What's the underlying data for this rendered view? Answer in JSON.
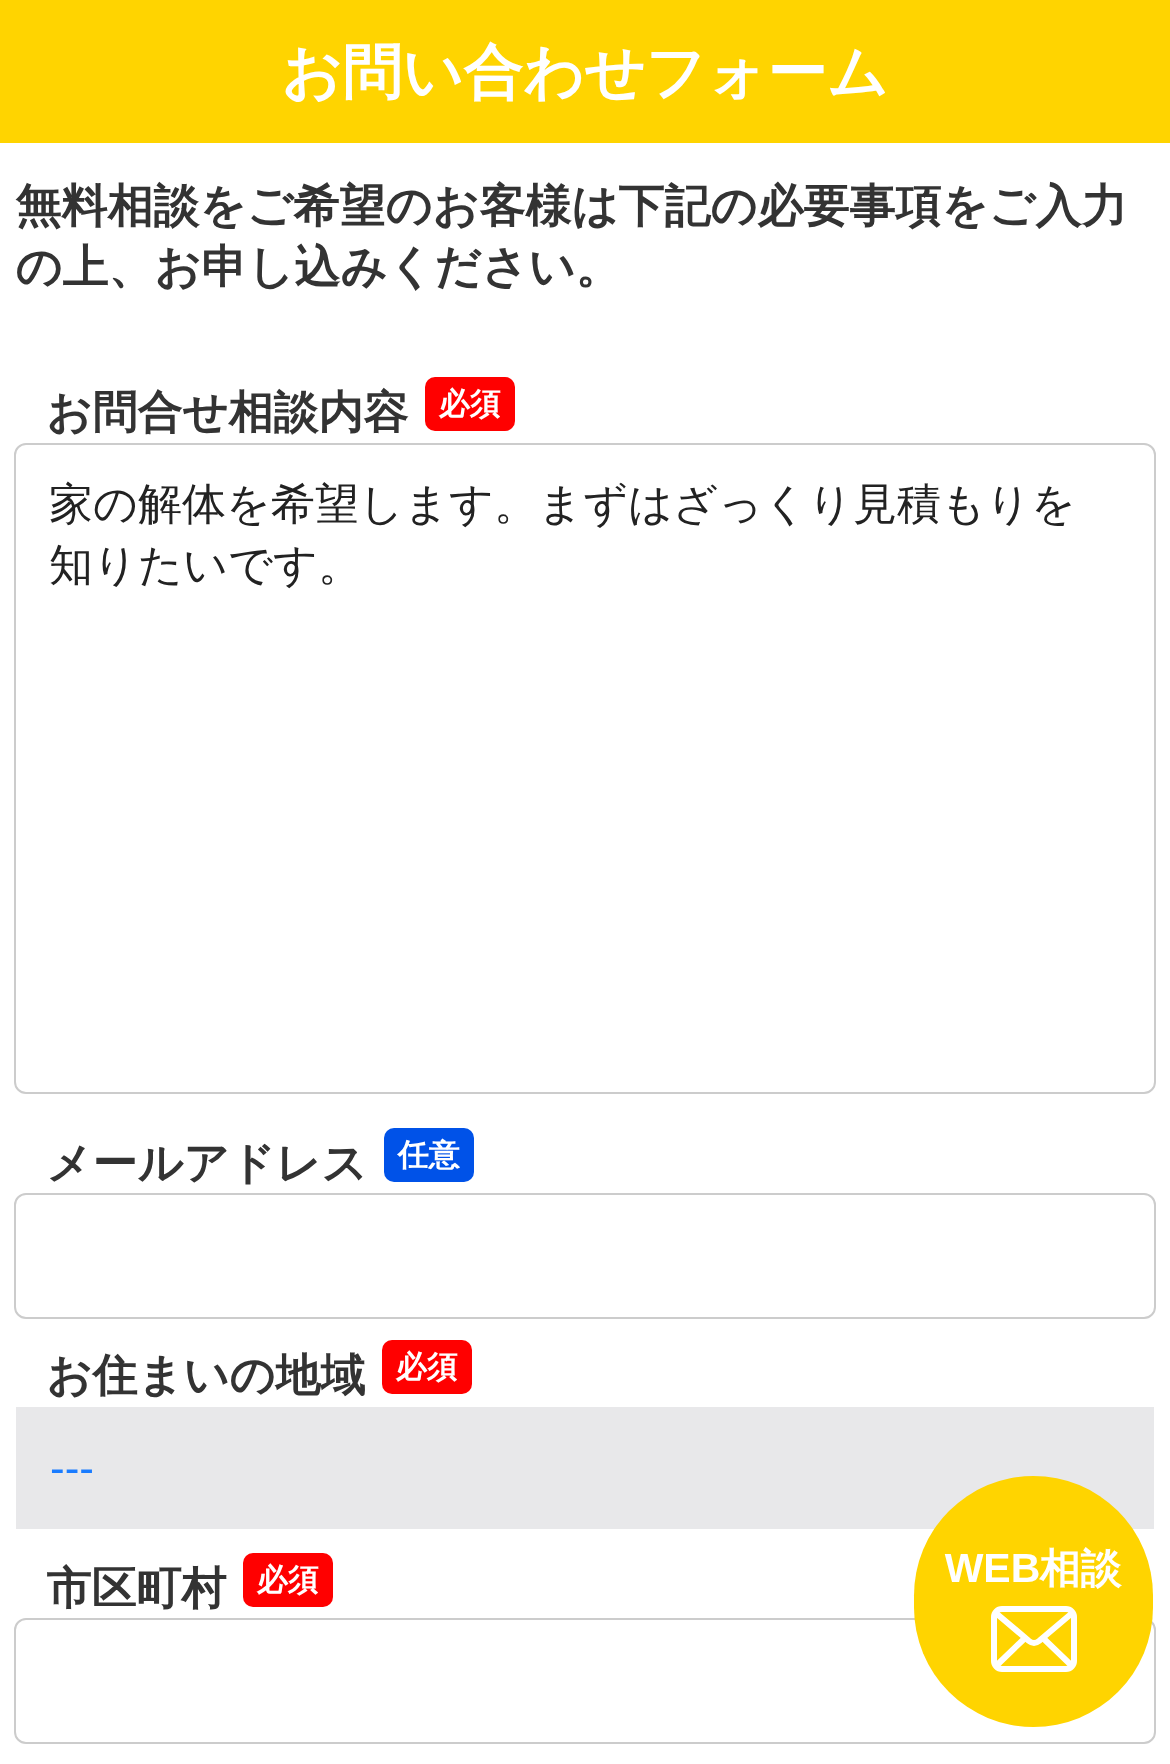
{
  "header": {
    "title": "お問い合わせフォーム"
  },
  "intro": "無料相談をご希望のお客様は下記の必要事項をご入力の上、お申し込みください。",
  "fields": [
    {
      "kind": "textarea",
      "label": "お問合せ相談内容",
      "badge": {
        "text": "必須",
        "required": true
      },
      "value": "家の解体を希望します。まずはざっくり見積もりを知りたいです。"
    },
    {
      "kind": "input",
      "label": "メールアドレス",
      "badge": {
        "text": "任意",
        "required": false
      }
    },
    {
      "kind": "select",
      "label": "お住まいの地域",
      "badge": {
        "text": "必須",
        "required": true
      },
      "value": "---"
    },
    {
      "kind": "input",
      "label": "市区町村",
      "badge": {
        "text": "必須",
        "required": true
      }
    }
  ],
  "floating_button": {
    "label": "WEB相談"
  }
}
